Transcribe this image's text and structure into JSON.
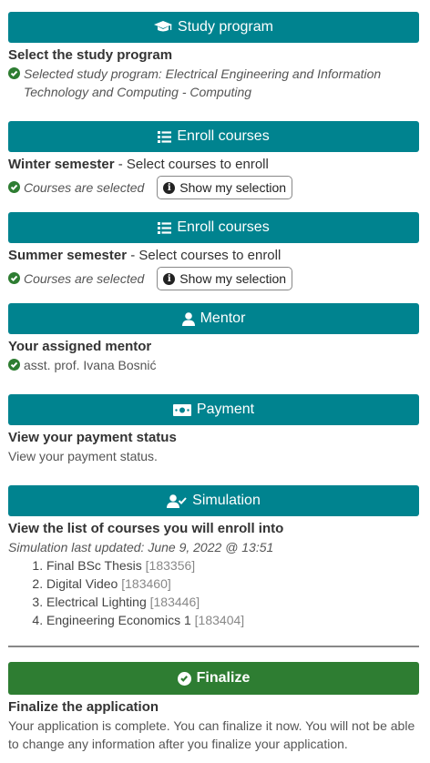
{
  "colors": {
    "teal": "#00838f",
    "green": "#2e7d32"
  },
  "study_program": {
    "button_label": "Study program",
    "button_icon": "graduation-cap-icon",
    "title": "Select the study program",
    "status": "Selected study program: Electrical Engineering and Information Technology and Computing - Computing"
  },
  "winter": {
    "button_label": "Enroll courses",
    "button_icon": "list-icon",
    "title_bold": "Winter semester",
    "title_rest": " - Select courses to enroll",
    "status": "Courses are selected",
    "selection_button": "Show my selection"
  },
  "summer": {
    "button_label": "Enroll courses",
    "button_icon": "list-icon",
    "title_bold": "Summer semester",
    "title_rest": " - Select courses to enroll",
    "status": "Courses are selected",
    "selection_button": "Show my selection"
  },
  "mentor": {
    "button_label": "Mentor",
    "button_icon": "user-icon",
    "title": "Your assigned mentor",
    "name": "asst. prof. Ivana Bosnić"
  },
  "payment": {
    "button_label": "Payment",
    "button_icon": "money-bill-icon",
    "title": "View your payment status",
    "text": "View your payment status."
  },
  "simulation": {
    "button_label": "Simulation",
    "button_icon": "user-check-icon",
    "title": "View the list of courses you will enroll into",
    "updated": "Simulation last updated: June 9, 2022 @ 13:51",
    "courses": [
      {
        "name": "Final BSc Thesis",
        "id": "[183356]"
      },
      {
        "name": "Digital Video",
        "id": "[183460]"
      },
      {
        "name": "Electrical Lighting",
        "id": "[183446]"
      },
      {
        "name": "Engineering Economics 1",
        "id": "[183404]"
      }
    ]
  },
  "finalize": {
    "button_label": "Finalize",
    "button_icon": "check-circle-icon",
    "title": "Finalize the application",
    "text": "Your application is complete. You can finalize it now. You will not be able to change any information after you finalize your application."
  }
}
